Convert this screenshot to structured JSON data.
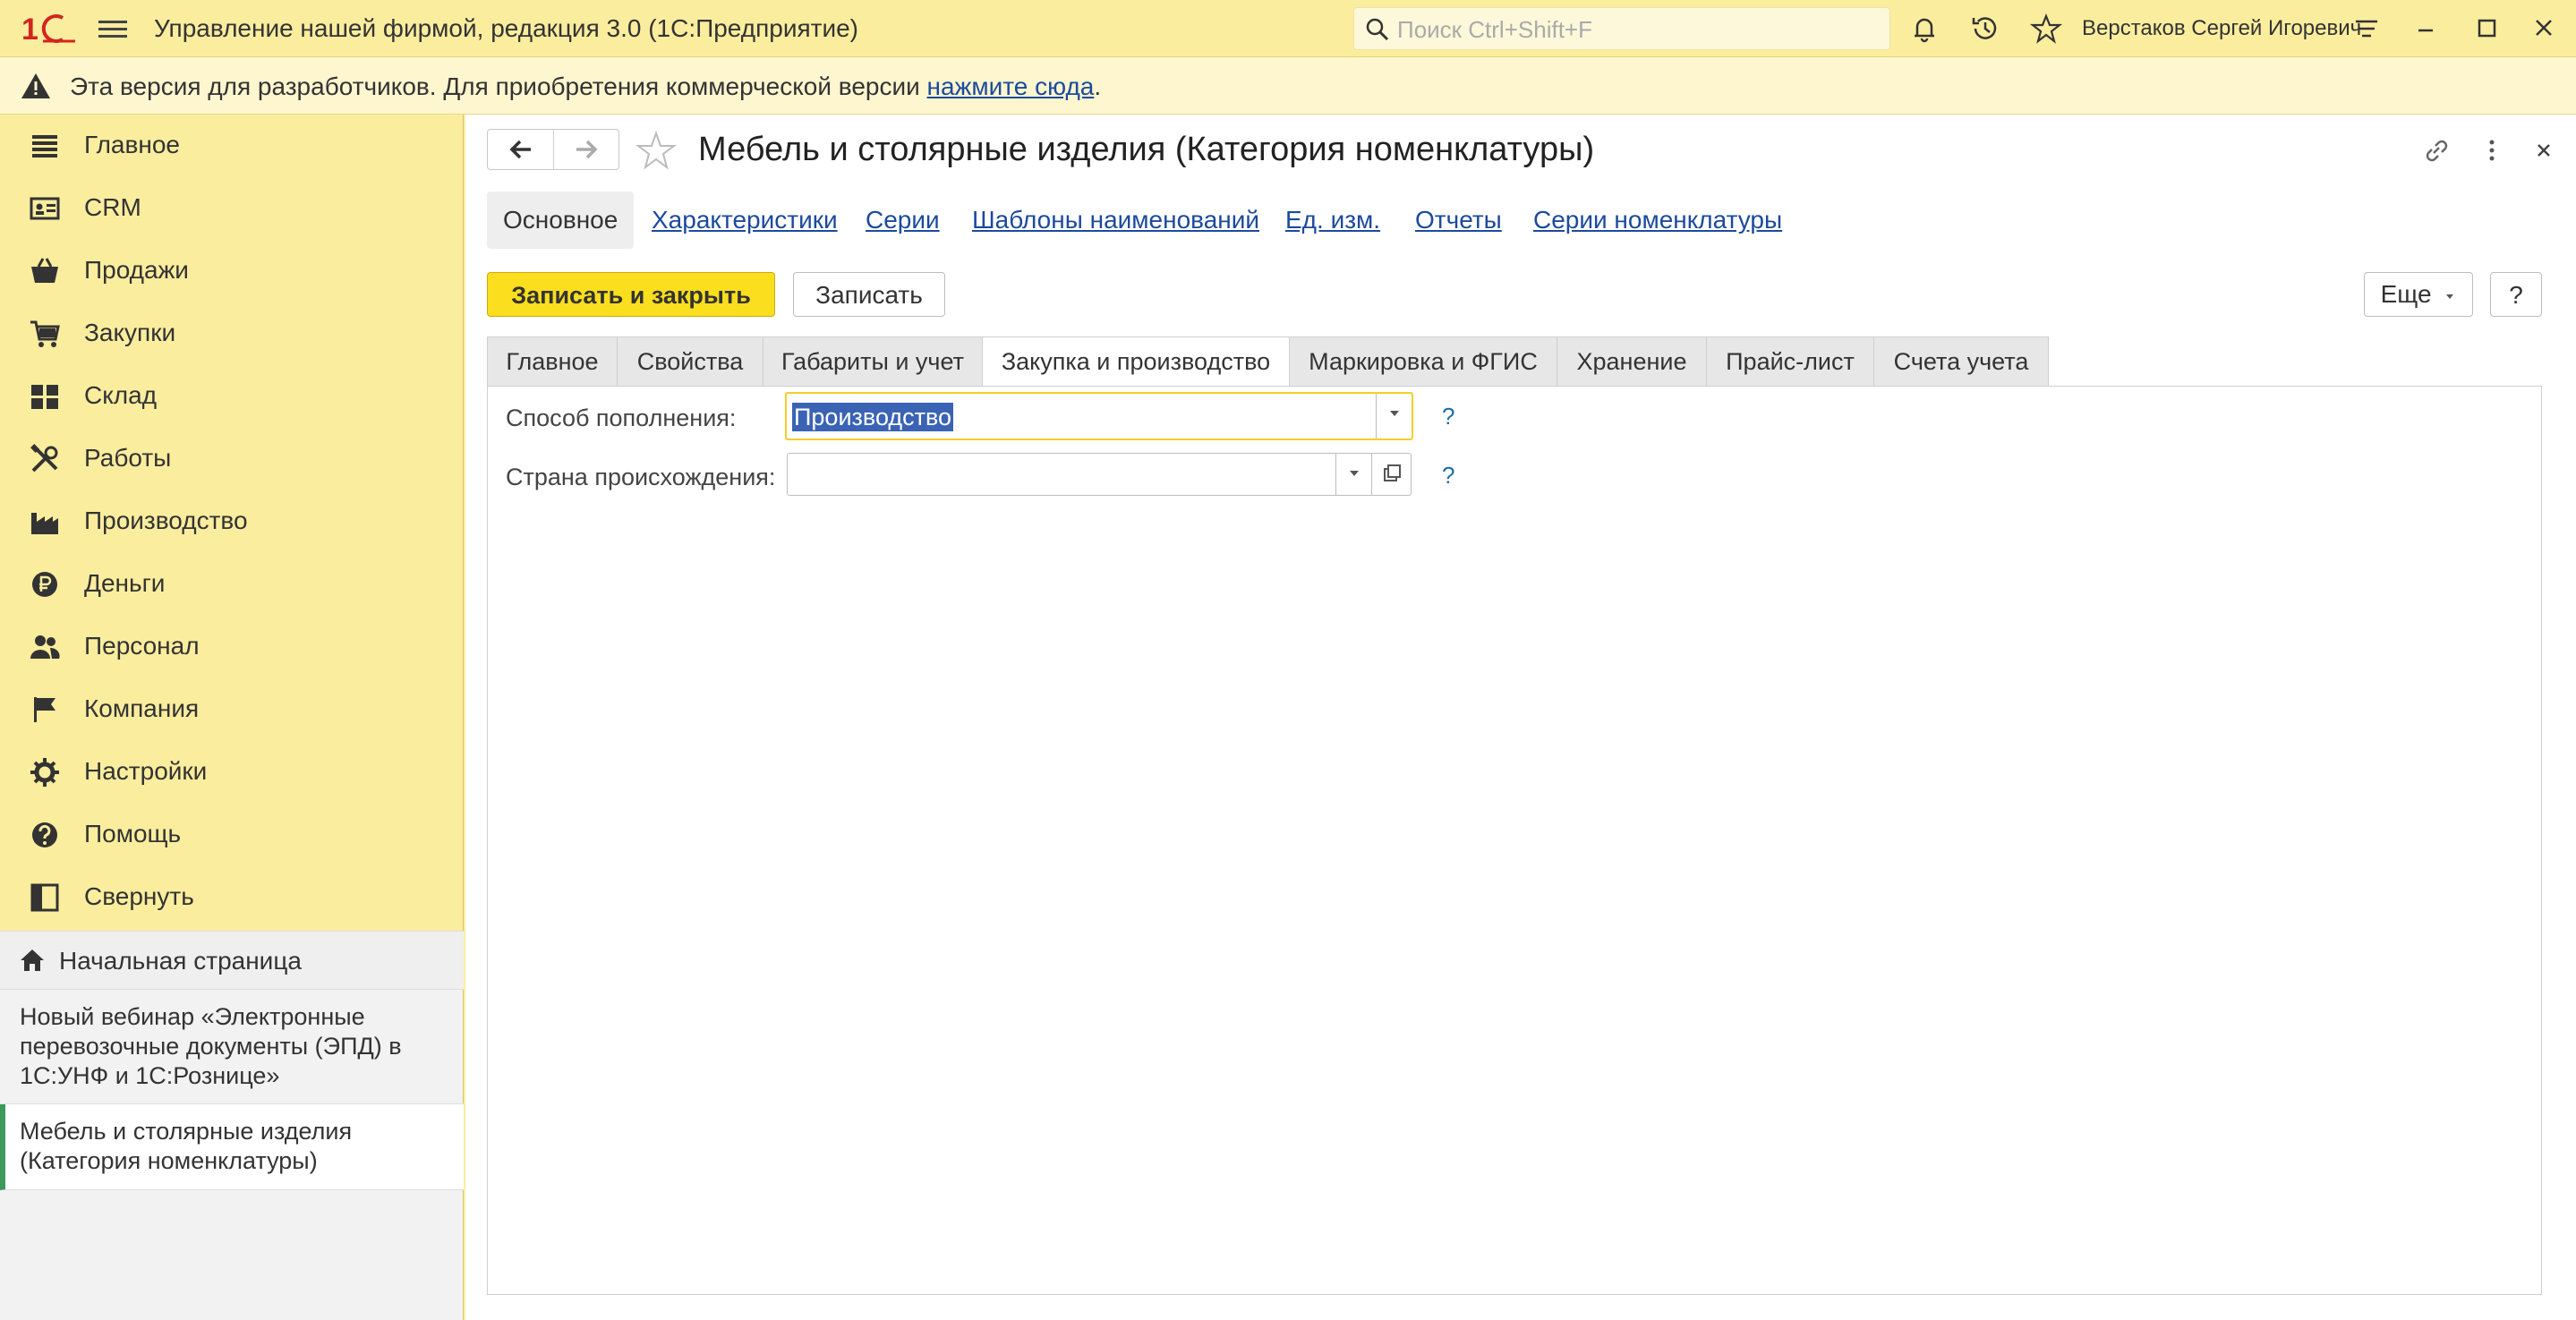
{
  "app": {
    "title": "Управление нашей фирмой, редакция 3.0  (1С:Предприятие)",
    "logo_text": "1С",
    "search_placeholder": "Поиск Ctrl+Shift+F",
    "user_name": "Верстаков Сергей Игоревич"
  },
  "notice": {
    "text": "Эта версия для разработчиков. Для приобретения коммерческой версии ",
    "link": "нажмите сюда",
    "suffix": "."
  },
  "sidebar": {
    "items": [
      {
        "label": "Главное",
        "icon": "menu-lines-icon"
      },
      {
        "label": "CRM",
        "icon": "crm-card-icon"
      },
      {
        "label": "Продажи",
        "icon": "basket-icon"
      },
      {
        "label": "Закупки",
        "icon": "cart-icon"
      },
      {
        "label": "Склад",
        "icon": "warehouse-icon"
      },
      {
        "label": "Работы",
        "icon": "tools-icon"
      },
      {
        "label": "Производство",
        "icon": "factory-icon"
      },
      {
        "label": "Деньги",
        "icon": "ruble-coin-icon"
      },
      {
        "label": "Персонал",
        "icon": "people-icon"
      },
      {
        "label": "Компания",
        "icon": "flag-icon"
      },
      {
        "label": "Настройки",
        "icon": "gear-icon"
      },
      {
        "label": "Помощь",
        "icon": "help-circle-icon"
      },
      {
        "label": "Свернуть",
        "icon": "collapse-panel-icon"
      }
    ],
    "home": "Начальная страница",
    "open_windows": [
      "Новый вебинар «Электронные перевозочные документы (ЭПД) в 1С:УНФ и 1С:Рознице»",
      "Мебель и столярные изделия (Категория номенклатуры)"
    ]
  },
  "document": {
    "title": "Мебель и столярные изделия (Категория номенклатуры)",
    "subtabs": [
      "Основное",
      "Характеристики",
      "Серии",
      "Шаблоны наименований",
      "Ед. изм.",
      "Отчеты",
      "Серии номенклатуры"
    ],
    "buttons": {
      "save_close": "Записать и закрыть",
      "save": "Записать",
      "more": "Еще",
      "help": "?"
    },
    "form_tabs": [
      "Главное",
      "Свойства",
      "Габариты и учет",
      "Закупка и производство",
      "Маркировка и ФГИС",
      "Хранение",
      "Прайс-лист",
      "Счета учета"
    ],
    "active_form_tab": "Закупка и производство",
    "fields": [
      {
        "label": "Способ пополнения:",
        "value": "Производство",
        "help": "?"
      },
      {
        "label": "Страна происхождения:",
        "value": "",
        "help": "?"
      }
    ]
  },
  "colors": {
    "accent_yellow": "#fbde1e",
    "sidebar_bg": "#fbed9e",
    "link": "#1c4a9c",
    "active_marker": "#3c9a5a"
  }
}
